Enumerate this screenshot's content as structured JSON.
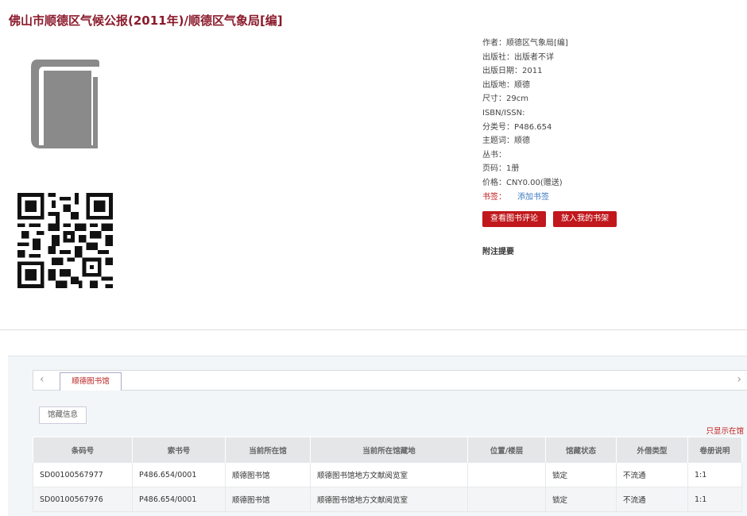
{
  "title": "佛山市顺德区气候公报(2011年)/顺德区气象局[编]",
  "cover_icon": "book-icon",
  "qr_icon": "qr-code-icon",
  "meta": [
    "作者：顺德区气象局[编]",
    "出版社：出版者不详",
    "出版日期：2011",
    "出版地：顺德",
    "尺寸：29cm",
    "ISBN/ISSN:",
    "分类号：P486.654",
    "主题词：顺德",
    "丛书：",
    "页码：1册",
    "价格：CNY0.00(赠送)"
  ],
  "bookmark": {
    "label": "书签：",
    "link": "添加书签"
  },
  "buttons": {
    "review": "查看图书评论",
    "shelf": "放入我的书架"
  },
  "note_heading": "附注提要",
  "holdings": {
    "left_arrow": "‹",
    "right_arrow": "›",
    "library_tab": "顺德图书馆",
    "holding_tab": "馆藏信息",
    "only_show": "只显示在馆",
    "columns": [
      "条码号",
      "索书号",
      "当前所在馆",
      "当前所在馆藏地",
      "位置/楼层",
      "馆藏状态",
      "外借类型",
      "卷册说明"
    ],
    "rows": [
      [
        "SD00100567977",
        "P486.654/0001",
        "顺德图书馆",
        "顺德图书馆地方文献阅览室",
        "",
        "锁定",
        "不流通",
        "1:1"
      ],
      [
        "SD00100567976",
        "P486.654/0001",
        "顺德图书馆",
        "顺德图书馆地方文献阅览室",
        "",
        "锁定",
        "不流通",
        "1:1"
      ]
    ]
  }
}
